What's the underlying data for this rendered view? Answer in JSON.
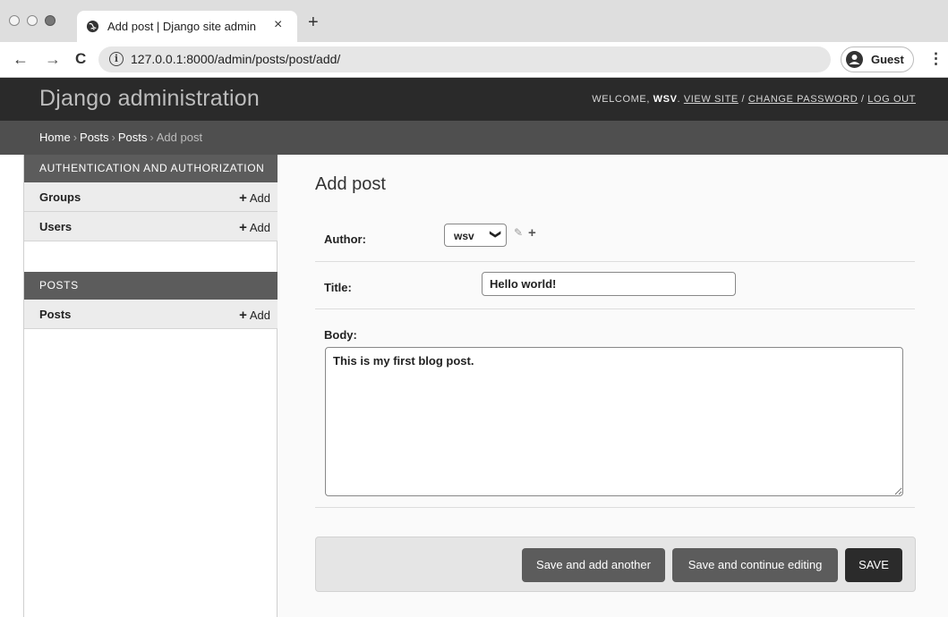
{
  "browser": {
    "tab_title": "Add post | Django site admin",
    "tab_close": "×",
    "new_tab": "+",
    "url": "127.0.0.1:8000/admin/posts/post/add/",
    "profile_label": "Guest",
    "back": "←",
    "forward": "→",
    "reload": "C",
    "info": "i",
    "menu": "⋮"
  },
  "header": {
    "brand": "Django administration",
    "welcome": "Welcome,",
    "username": "wsv",
    "view_site": "View site",
    "change_password": "Change password",
    "log_out": "Log out"
  },
  "breadcrumbs": [
    "Home",
    "Posts",
    "Posts",
    "Add post"
  ],
  "sidebar": {
    "add_label": "Add",
    "modules": [
      {
        "caption": "Authentication and Authorization",
        "models": [
          "Groups",
          "Users"
        ]
      },
      {
        "caption": "Posts",
        "models": [
          "Posts"
        ]
      }
    ]
  },
  "form": {
    "title": "Add post",
    "author_label": "Author:",
    "author_value": "wsv",
    "title_label": "Title:",
    "title_value": "Hello world!",
    "body_label": "Body:",
    "body_value": "This is my first blog post."
  },
  "buttons": {
    "save_add_another": "Save and add another",
    "save_continue": "Save and continue editing",
    "save": "SAVE"
  }
}
